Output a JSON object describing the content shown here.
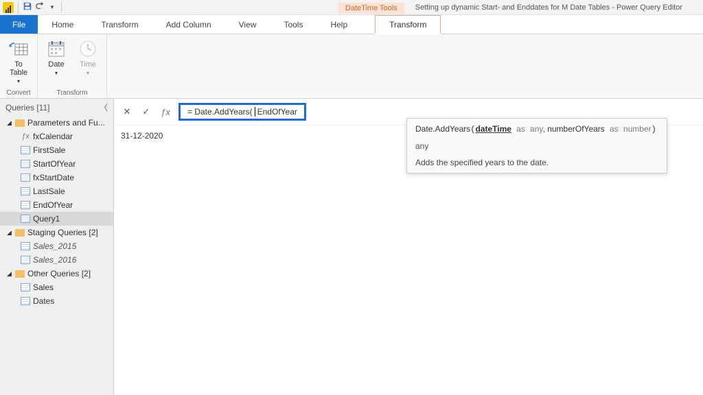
{
  "titlebar": {
    "context_tab": "DateTime Tools",
    "title": "Setting up dynamic Start- and Enddates for M Date Tables - Power Query Editor"
  },
  "menu": {
    "file": "File",
    "tabs": [
      "Home",
      "Transform",
      "Add Column",
      "View",
      "Tools",
      "Help"
    ],
    "context_tab": "Transform"
  },
  "ribbon": {
    "convert": {
      "to_table": "To\nTable",
      "group": "Convert"
    },
    "transform": {
      "date": "Date",
      "time": "Time",
      "group": "Transform"
    }
  },
  "queries": {
    "header": "Queries [11]",
    "groups": [
      {
        "label": "Parameters and Fu...",
        "items": [
          {
            "name": "fxCalendar",
            "icon": "fx"
          },
          {
            "name": "FirstSale",
            "icon": "table"
          },
          {
            "name": "StartOfYear",
            "icon": "table"
          },
          {
            "name": "fxStartDate",
            "icon": "table"
          },
          {
            "name": "LastSale",
            "icon": "table"
          },
          {
            "name": "EndOfYear",
            "icon": "table"
          },
          {
            "name": "Query1",
            "icon": "table",
            "selected": true
          }
        ]
      },
      {
        "label": "Staging Queries [2]",
        "items": [
          {
            "name": "Sales_2015",
            "icon": "table",
            "italic": true
          },
          {
            "name": "Sales_2016",
            "icon": "table",
            "italic": true
          }
        ]
      },
      {
        "label": "Other Queries [2]",
        "items": [
          {
            "name": "Sales",
            "icon": "table"
          },
          {
            "name": "Dates",
            "icon": "table"
          }
        ]
      }
    ]
  },
  "formula_bar": {
    "prefix": "= Date.AddYears(",
    "suffix": "EndOfYear"
  },
  "preview": {
    "value": "31-12-2020"
  },
  "tooltip": {
    "fn": "Date.AddYears",
    "param1": "dateTime",
    "kw_as": "as",
    "type1": "any",
    "sep": ", ",
    "param2": "numberOfYears",
    "type2": "number",
    "return_type": "any",
    "description": "Adds the specified years to the date."
  }
}
